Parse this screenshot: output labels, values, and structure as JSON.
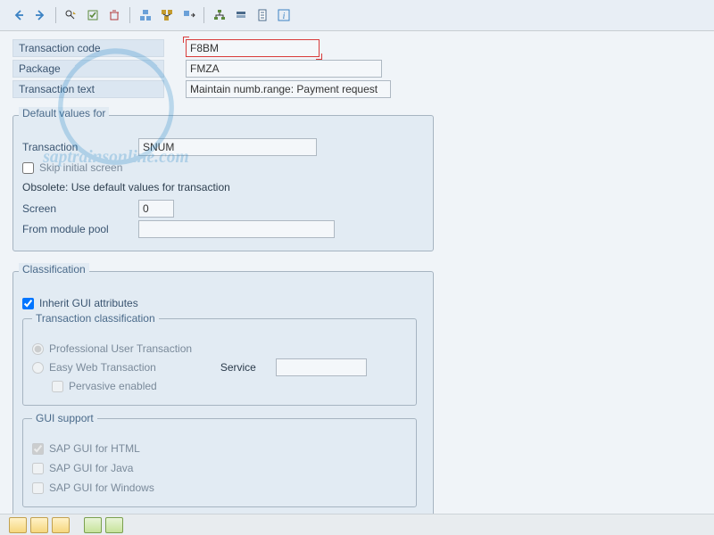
{
  "header": {
    "transaction_code_label": "Transaction code",
    "transaction_code_value": "F8BM",
    "package_label": "Package",
    "package_value": "FMZA",
    "transaction_text_label": "Transaction text",
    "transaction_text_value": "Maintain numb.range: Payment request"
  },
  "defaults": {
    "title": "Default values for",
    "transaction_label": "Transaction",
    "transaction_value": "SNUM",
    "skip_initial_label": "Skip initial screen",
    "skip_initial_checked": false,
    "obsolete_note": "Obsolete: Use default values for transaction",
    "screen_label": "Screen",
    "screen_value": "0",
    "from_module_pool_label": "From module pool",
    "from_module_pool_value": ""
  },
  "classification": {
    "title": "Classification",
    "inherit_label": "Inherit GUI attributes",
    "inherit_checked": true,
    "tc_title": "Transaction classification",
    "prof_label": "Professional User Transaction",
    "prof_selected": true,
    "easy_label": "Easy Web Transaction",
    "easy_selected": false,
    "service_label": "Service",
    "service_value": "",
    "pervasive_label": "Pervasive enabled",
    "pervasive_checked": false,
    "gui_title": "GUI support",
    "gui_html_label": "SAP GUI for HTML",
    "gui_html_checked": true,
    "gui_java_label": "SAP GUI for Java",
    "gui_java_checked": false,
    "gui_win_label": "SAP GUI for Windows",
    "gui_win_checked": false
  },
  "watermark_text": "saptrainsonline.com"
}
